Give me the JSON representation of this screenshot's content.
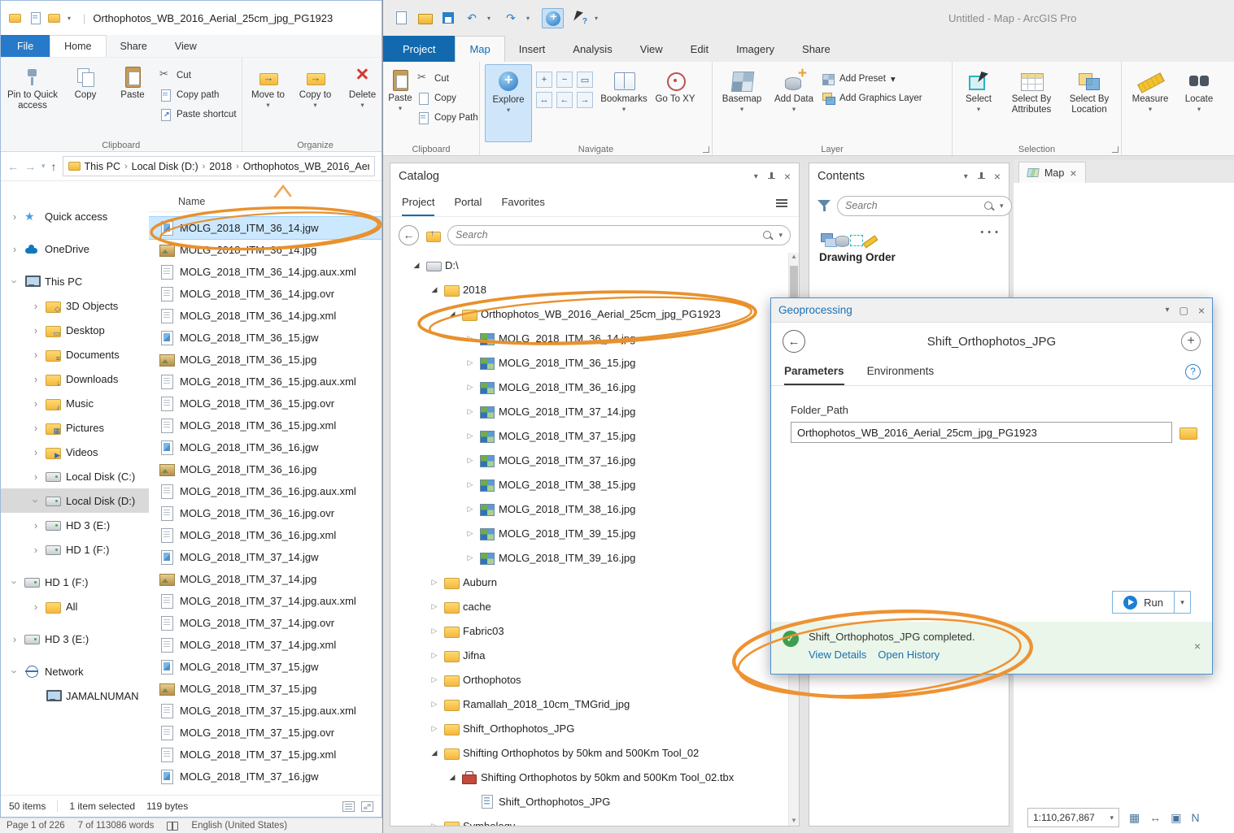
{
  "icons": {
    "close": "×",
    "dropdown": "▾",
    "back": "←",
    "forward": "→",
    "up": "↑",
    "undo": "↶",
    "redo": "↷",
    "help": "?",
    "plus": "+",
    "minus": "−",
    "scroll_up": "▲",
    "scroll_down": "▼",
    "ellipsis": "• • •",
    "zoom_box": "▭",
    "swap": "↔",
    "grid": "▦",
    "north": "N",
    "square": "▣"
  },
  "explorer": {
    "window_title": "Orthophotos_WB_2016_Aerial_25cm_jpg_PG1923",
    "menu": [
      {
        "label": "File",
        "cls": "file"
      },
      {
        "label": "Home",
        "cls": "active"
      },
      {
        "label": "Share"
      },
      {
        "label": "View"
      }
    ],
    "ribbon": {
      "pin_label": "Pin to Quick access",
      "copy_label": "Copy",
      "paste_label": "Paste",
      "cut_label": "Cut",
      "copy_path_label": "Copy path",
      "paste_shortcut_label": "Paste shortcut",
      "clipboard_group": "Clipboard",
      "move_to_label": "Move to",
      "copy_to_label": "Copy to",
      "delete_label": "Delete",
      "organize_group": "Organize"
    },
    "breadcrumb": [
      "This PC",
      "Local Disk (D:)",
      "2018",
      "Orthophotos_WB_2016_Aerial_25cm_jpg_PG1923"
    ],
    "column_name": "Name",
    "sidebar": [
      {
        "label": "Quick access",
        "cls": "lvl0 ic-star chev-c"
      },
      {
        "label": "OneDrive",
        "cls": "lvl0 ic-cloud gap chev-c"
      },
      {
        "label": "This PC",
        "cls": "lvl0 ic-pc gap chev-o"
      },
      {
        "label": "3D Objects",
        "cls": "lvl1 ic-f3d chev-c"
      },
      {
        "label": "Desktop",
        "cls": "lvl1 ic-fdesk chev-c"
      },
      {
        "label": "Documents",
        "cls": "lvl1 ic-fdoc chev-c"
      },
      {
        "label": "Downloads",
        "cls": "lvl1 ic-fdown chev-c"
      },
      {
        "label": "Music",
        "cls": "lvl1 ic-fmus chev-c"
      },
      {
        "label": "Pictures",
        "cls": "lvl1 ic-fpic chev-c"
      },
      {
        "label": "Videos",
        "cls": "lvl1 ic-fvid chev-c"
      },
      {
        "label": "Local Disk (C:)",
        "cls": "lvl1 ic-drive chev-c"
      },
      {
        "label": "Local Disk (D:)",
        "cls": "lvl1 ic-drive sel chev-o"
      },
      {
        "label": "HD 3 (E:)",
        "cls": "lvl1 ic-drive chev-c"
      },
      {
        "label": "HD 1 (F:)",
        "cls": "lvl1 ic-drive chev-c"
      },
      {
        "label": "HD 1 (F:)",
        "cls": "lvl0 ic-drive gap chev-o"
      },
      {
        "label": "All",
        "cls": "lvl1 ic-folder chev-c"
      },
      {
        "label": "HD 3 (E:)",
        "cls": "lvl0 ic-drive gap chev-c"
      },
      {
        "label": "Network",
        "cls": "lvl0 ic-net gap chev-o"
      },
      {
        "label": "JAMALNUMAN",
        "cls": "lvl1 ic-pc"
      }
    ],
    "files": [
      {
        "name": "MOLG_2018_ITM_36_14.jgw",
        "cls": "jgw sel"
      },
      {
        "name": "MOLG_2018_ITM_36_14.jpg",
        "cls": "jpg"
      },
      {
        "name": "MOLG_2018_ITM_36_14.jpg.aux.xml",
        "cls": "doc"
      },
      {
        "name": "MOLG_2018_ITM_36_14.jpg.ovr",
        "cls": "doc"
      },
      {
        "name": "MOLG_2018_ITM_36_14.jpg.xml",
        "cls": "doc"
      },
      {
        "name": "MOLG_2018_ITM_36_15.jgw",
        "cls": "jgw"
      },
      {
        "name": "MOLG_2018_ITM_36_15.jpg",
        "cls": "jpg"
      },
      {
        "name": "MOLG_2018_ITM_36_15.jpg.aux.xml",
        "cls": "doc"
      },
      {
        "name": "MOLG_2018_ITM_36_15.jpg.ovr",
        "cls": "doc"
      },
      {
        "name": "MOLG_2018_ITM_36_15.jpg.xml",
        "cls": "doc"
      },
      {
        "name": "MOLG_2018_ITM_36_16.jgw",
        "cls": "jgw"
      },
      {
        "name": "MOLG_2018_ITM_36_16.jpg",
        "cls": "jpg"
      },
      {
        "name": "MOLG_2018_ITM_36_16.jpg.aux.xml",
        "cls": "doc"
      },
      {
        "name": "MOLG_2018_ITM_36_16.jpg.ovr",
        "cls": "doc"
      },
      {
        "name": "MOLG_2018_ITM_36_16.jpg.xml",
        "cls": "doc"
      },
      {
        "name": "MOLG_2018_ITM_37_14.jgw",
        "cls": "jgw"
      },
      {
        "name": "MOLG_2018_ITM_37_14.jpg",
        "cls": "jpg"
      },
      {
        "name": "MOLG_2018_ITM_37_14.jpg.aux.xml",
        "cls": "doc"
      },
      {
        "name": "MOLG_2018_ITM_37_14.jpg.ovr",
        "cls": "doc"
      },
      {
        "name": "MOLG_2018_ITM_37_14.jpg.xml",
        "cls": "doc"
      },
      {
        "name": "MOLG_2018_ITM_37_15.jgw",
        "cls": "jgw"
      },
      {
        "name": "MOLG_2018_ITM_37_15.jpg",
        "cls": "jpg"
      },
      {
        "name": "MOLG_2018_ITM_37_15.jpg.aux.xml",
        "cls": "doc"
      },
      {
        "name": "MOLG_2018_ITM_37_15.jpg.ovr",
        "cls": "doc"
      },
      {
        "name": "MOLG_2018_ITM_37_15.jpg.xml",
        "cls": "doc"
      },
      {
        "name": "MOLG_2018_ITM_37_16.jgw",
        "cls": "jgw"
      }
    ],
    "status_items": "50 items",
    "status_selected": "1 item selected",
    "status_size": "119 bytes"
  },
  "word_statusbar": {
    "page": "Page 1 of 226",
    "words": "7 of 113086 words",
    "language": "English (United States)"
  },
  "arcgis": {
    "window_title": "Untitled - Map - ArcGIS Pro",
    "ribbon_tabs": [
      {
        "label": "Project",
        "cls": "project"
      },
      {
        "label": "Map",
        "cls": "active"
      },
      {
        "label": "Insert"
      },
      {
        "label": "Analysis"
      },
      {
        "label": "View"
      },
      {
        "label": "Edit"
      },
      {
        "label": "Imagery"
      },
      {
        "label": "Share"
      }
    ],
    "ribbon": {
      "paste": "Paste",
      "cut": "Cut",
      "copy": "Copy",
      "copy_path": "Copy Path",
      "clipboard_group": "Clipboard",
      "explore": "Explore",
      "bookmarks": "Bookmarks",
      "go_to_xy": "Go To XY",
      "navigate_group": "Navigate",
      "basemap": "Basemap",
      "add_data": "Add Data",
      "add_preset": "Add Preset",
      "add_graphics": "Add Graphics Layer",
      "layer_group": "Layer",
      "select": "Select",
      "select_by_attributes": "Select By Attributes",
      "select_by_location": "Select By Location",
      "selection_group": "Selection",
      "measure": "Measure",
      "locate": "Locate"
    },
    "catalog": {
      "title": "Catalog",
      "tabs": [
        {
          "label": "Project",
          "cls": "active"
        },
        {
          "label": "Portal"
        },
        {
          "label": "Favorites"
        }
      ],
      "search_placeholder": "Search",
      "tree": [
        {
          "label": "D:\\",
          "cls": "lvl0 open t-drive"
        },
        {
          "label": "2018",
          "cls": "lvl1 open t-folder"
        },
        {
          "label": "Orthophotos_WB_2016_Aerial_25cm_jpg_PG1923",
          "cls": "lvl2 open t-folder"
        },
        {
          "label": "MOLG_2018_ITM_36_14.jpg",
          "cls": "lvl3 closed t-raster"
        },
        {
          "label": "MOLG_2018_ITM_36_15.jpg",
          "cls": "lvl3 closed t-raster"
        },
        {
          "label": "MOLG_2018_ITM_36_16.jpg",
          "cls": "lvl3 closed t-raster"
        },
        {
          "label": "MOLG_2018_ITM_37_14.jpg",
          "cls": "lvl3 closed t-raster"
        },
        {
          "label": "MOLG_2018_ITM_37_15.jpg",
          "cls": "lvl3 closed t-raster"
        },
        {
          "label": "MOLG_2018_ITM_37_16.jpg",
          "cls": "lvl3 closed t-raster"
        },
        {
          "label": "MOLG_2018_ITM_38_15.jpg",
          "cls": "lvl3 closed t-raster"
        },
        {
          "label": "MOLG_2018_ITM_38_16.jpg",
          "cls": "lvl3 closed t-raster"
        },
        {
          "label": "MOLG_2018_ITM_39_15.jpg",
          "cls": "lvl3 closed t-raster"
        },
        {
          "label": "MOLG_2018_ITM_39_16.jpg",
          "cls": "lvl3 closed t-raster"
        },
        {
          "label": "Auburn",
          "cls": "lvl1 closed t-folder"
        },
        {
          "label": "cache",
          "cls": "lvl1 closed t-folder"
        },
        {
          "label": "Fabric03",
          "cls": "lvl1 closed t-folder"
        },
        {
          "label": "Jifna",
          "cls": "lvl1 closed t-folder"
        },
        {
          "label": "Orthophotos",
          "cls": "lvl1 closed t-folder"
        },
        {
          "label": "Ramallah_2018_10cm_TMGrid_jpg",
          "cls": "lvl1 closed t-folder"
        },
        {
          "label": "Shift_Orthophotos_JPG",
          "cls": "lvl1 closed t-folder"
        },
        {
          "label": "Shifting Orthophotos by 50km and 500Km Tool_02",
          "cls": "lvl1 open t-folder"
        },
        {
          "label": "Shifting Orthophotos by 50km and 500Km Tool_02.tbx",
          "cls": "lvl2 open t-toolbox"
        },
        {
          "label": "Shift_Orthophotos_JPG",
          "cls": "lvl3 none t-tool"
        },
        {
          "label": "Symbology",
          "cls": "lvl1 closed t-folder"
        }
      ]
    },
    "contents": {
      "title": "Contents",
      "search_placeholder": "Search",
      "drawing_order": "Drawing Order"
    },
    "map_tab_label": "Map",
    "scale": "1:110,267,867"
  },
  "geoprocessing": {
    "panel_title": "Geoprocessing",
    "tool_title": "Shift_Orthophotos_JPG",
    "tabs": [
      {
        "label": "Parameters",
        "cls": "active"
      },
      {
        "label": "Environments"
      }
    ],
    "folder_path_label": "Folder_Path",
    "folder_path_value": "Orthophotos_WB_2016_Aerial_25cm_jpg_PG1923",
    "run_label": "Run",
    "completion_message": "Shift_Orthophotos_JPG completed.",
    "links": [
      "View Details",
      "Open History"
    ]
  }
}
